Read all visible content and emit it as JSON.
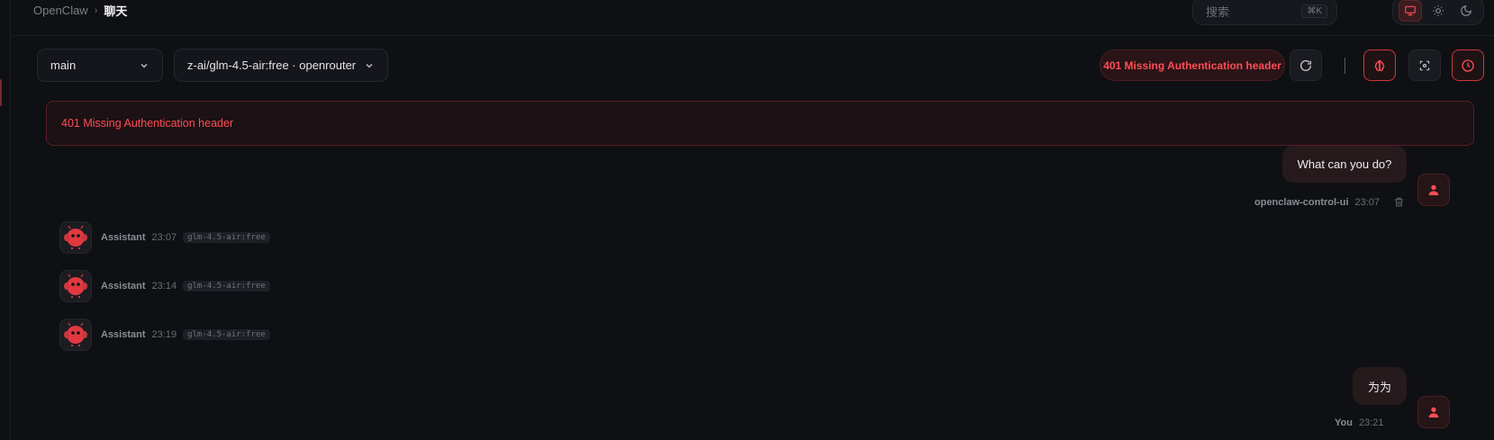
{
  "breadcrumb": {
    "root": "OpenClaw",
    "separator": "›",
    "current": "聊天"
  },
  "search": {
    "placeholder": "搜索",
    "shortcut": "⌘K"
  },
  "theme": {
    "options": [
      "system",
      "light",
      "dark"
    ],
    "active": "system"
  },
  "controls": {
    "session_value": "main",
    "model_value": "z-ai/glm-4.5-air:free · openrouter",
    "error_pill": "401 Missing Authentication header"
  },
  "banner": {
    "text": "401 Missing Authentication header"
  },
  "messages": [
    {
      "role": "user",
      "text": "What can you do?",
      "sender": "openclaw-control-ui",
      "time": "23:07"
    },
    {
      "role": "assistant",
      "sender": "Assistant",
      "time": "23:07",
      "model": "glm-4.5-air:free"
    },
    {
      "role": "assistant",
      "sender": "Assistant",
      "time": "23:14",
      "model": "glm-4.5-air:free"
    },
    {
      "role": "assistant",
      "sender": "Assistant",
      "time": "23:19",
      "model": "glm-4.5-air:free"
    },
    {
      "role": "user",
      "text": "为为",
      "sender": "You",
      "time": "23:21"
    }
  ],
  "colors": {
    "accent": "#ff4d55",
    "background": "#0f1014",
    "error_bg": "#1c1114"
  }
}
